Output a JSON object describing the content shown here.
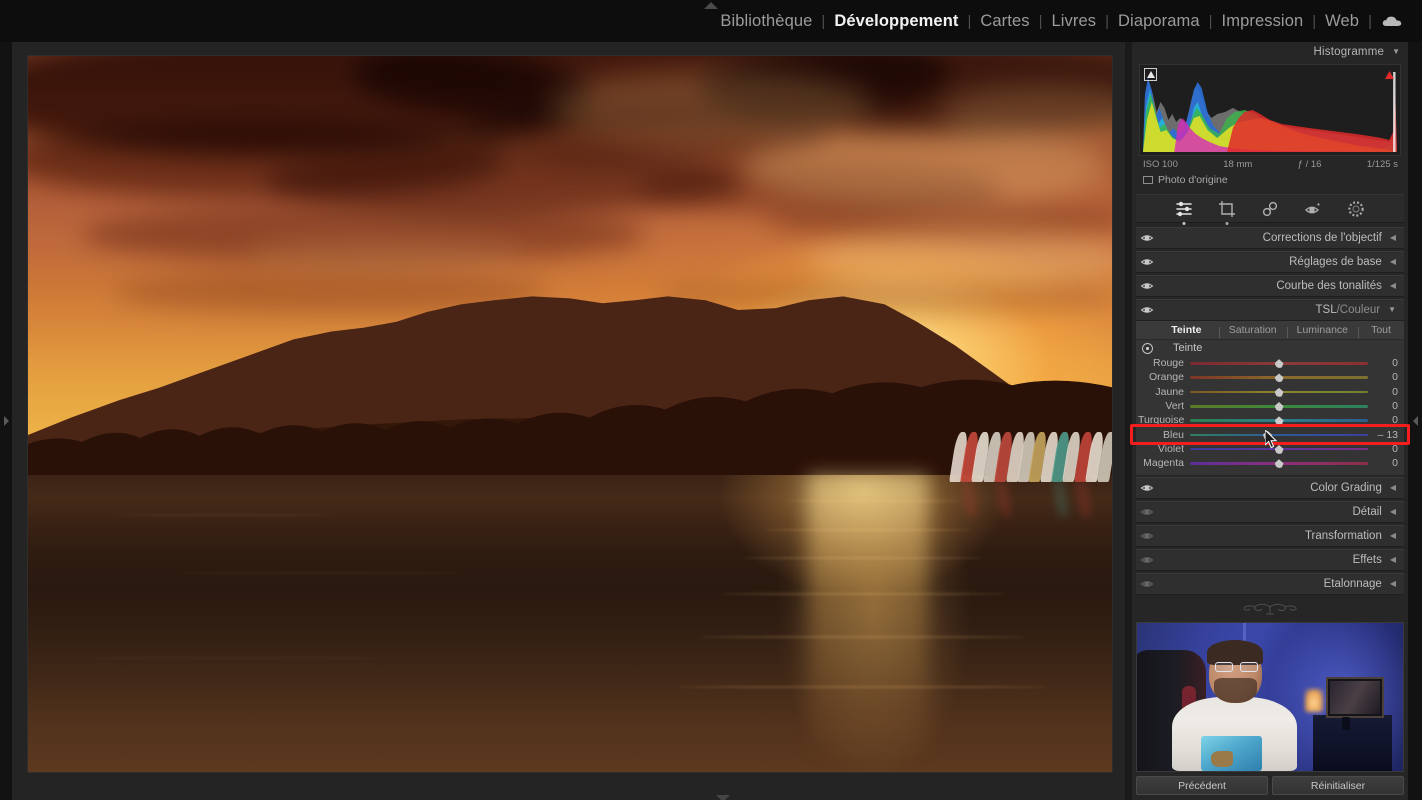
{
  "topbar": {
    "modules": [
      {
        "label": "Bibliothèque",
        "active": false
      },
      {
        "label": "Développement",
        "active": true
      },
      {
        "label": "Cartes",
        "active": false
      },
      {
        "label": "Livres",
        "active": false
      },
      {
        "label": "Diaporama",
        "active": false
      },
      {
        "label": "Impression",
        "active": false
      },
      {
        "label": "Web",
        "active": false
      }
    ],
    "separator": "|",
    "cloud_icon": "cloud-icon"
  },
  "histogram": {
    "title": "Histogramme",
    "collapse_glyph": "▼",
    "clip_shadow_icon": "shadow-clipping-icon",
    "clip_highlight_icon": "highlight-clipping-icon",
    "iso": "ISO 100",
    "focal": "18 mm",
    "aperture": "ƒ / 16",
    "shutter": "1/125 s",
    "original_photo": "Photo d'origine"
  },
  "toolstrip": {
    "tools": [
      {
        "name": "basic-sliders-tool",
        "selected": true
      },
      {
        "name": "crop-tool",
        "selected": false
      },
      {
        "name": "spot-removal-tool",
        "selected": false
      },
      {
        "name": "red-eye-tool",
        "selected": false
      },
      {
        "name": "masking-tool",
        "selected": false
      }
    ]
  },
  "sections": [
    {
      "label": "Corrections de l'objectif",
      "expanded": false,
      "eye_on": true,
      "glyph": "◀"
    },
    {
      "label": "Réglages de base",
      "expanded": false,
      "eye_on": true,
      "glyph": "◀"
    },
    {
      "label": "Courbe des tonalités",
      "expanded": false,
      "eye_on": true,
      "glyph": "◀"
    }
  ],
  "hsl": {
    "label_main": "TSL",
    "label_sep": "/",
    "label_alt": "Couleur",
    "collapse_glyph": "▼",
    "eye_on": true,
    "tabs": [
      {
        "label": "Teinte",
        "active": true
      },
      {
        "label": "Saturation",
        "active": false
      },
      {
        "label": "Luminance",
        "active": false
      },
      {
        "label": "Tout",
        "active": false
      }
    ],
    "targeted_adjust_icon": "targeted-adjustment-icon",
    "sub_title": "Teinte",
    "sliders": [
      {
        "label": "Rouge",
        "value": "0",
        "num": 0,
        "grad": "linear-gradient(to right,#7d2830,#8a3b3a 50%,#8a3030)"
      },
      {
        "label": "Orange",
        "value": "0",
        "num": 0,
        "grad": "linear-gradient(to right,#7d3526,#8a6a2c 50%,#7d7030)"
      },
      {
        "label": "Jaune",
        "value": "0",
        "num": 0,
        "grad": "linear-gradient(to right,#7d5a24,#8a8430 50%,#6f8230)"
      },
      {
        "label": "Vert",
        "value": "0",
        "num": 0,
        "grad": "linear-gradient(to right,#5c7a28,#3d8a3c 50%,#2d8060)"
      },
      {
        "label": "Turquoise",
        "value": "0",
        "num": 0,
        "grad": "linear-gradient(to right,#2d8050,#2d7f8a 50%,#2d5f8a)"
      },
      {
        "label": "Bleu",
        "value": "– 13",
        "num": -13,
        "grad": "linear-gradient(to right,#2f8060,#2d5a9a 50%,#3c3f9e)",
        "highlight": true
      },
      {
        "label": "Violet",
        "value": "0",
        "num": 0,
        "grad": "linear-gradient(to right,#3a3c9c,#5c35a0 50%,#7c2f86)"
      },
      {
        "label": "Magenta",
        "value": "0",
        "num": 0,
        "grad": "linear-gradient(to right,#5c2f9a,#8c2f7c 50%,#8c2f48)"
      }
    ]
  },
  "sections_lower": [
    {
      "label": "Color Grading",
      "expanded": false,
      "eye_on": true,
      "glyph": "◀"
    },
    {
      "label": "Détail",
      "expanded": false,
      "eye_on": false,
      "glyph": "◀"
    },
    {
      "label": "Transformation",
      "expanded": false,
      "eye_on": false,
      "glyph": "◀"
    },
    {
      "label": "Effets",
      "expanded": false,
      "eye_on": false,
      "glyph": "◀"
    },
    {
      "label": "Etalonnage",
      "expanded": false,
      "eye_on": false,
      "glyph": "◀"
    }
  ],
  "buttons": {
    "previous": "Précédent",
    "reset": "Réinitialiser"
  },
  "viewer": {
    "photo_description": "Coucher de soleil orange sur un lac avec silhouette de montagne et pédalos",
    "left_collapse_icon": "collapse-left-arrow-icon",
    "right_collapse_icon": "collapse-right-arrow-icon",
    "top_collapse_icon": "collapse-top-arrow-icon",
    "bottom_collapse_icon": "collapse-bottom-arrow-icon"
  },
  "overlay": {
    "webcam_label": "webcam-overlay",
    "highlight_color": "#f51d1d",
    "cursor_icon": "mouse-cursor-icon"
  },
  "colors": {
    "panel_bg": "#262626",
    "section_bg": "#2f2f2f",
    "hsl_bg": "#343434",
    "accent_red": "#f51d1d",
    "text": "#bcbcbc"
  }
}
